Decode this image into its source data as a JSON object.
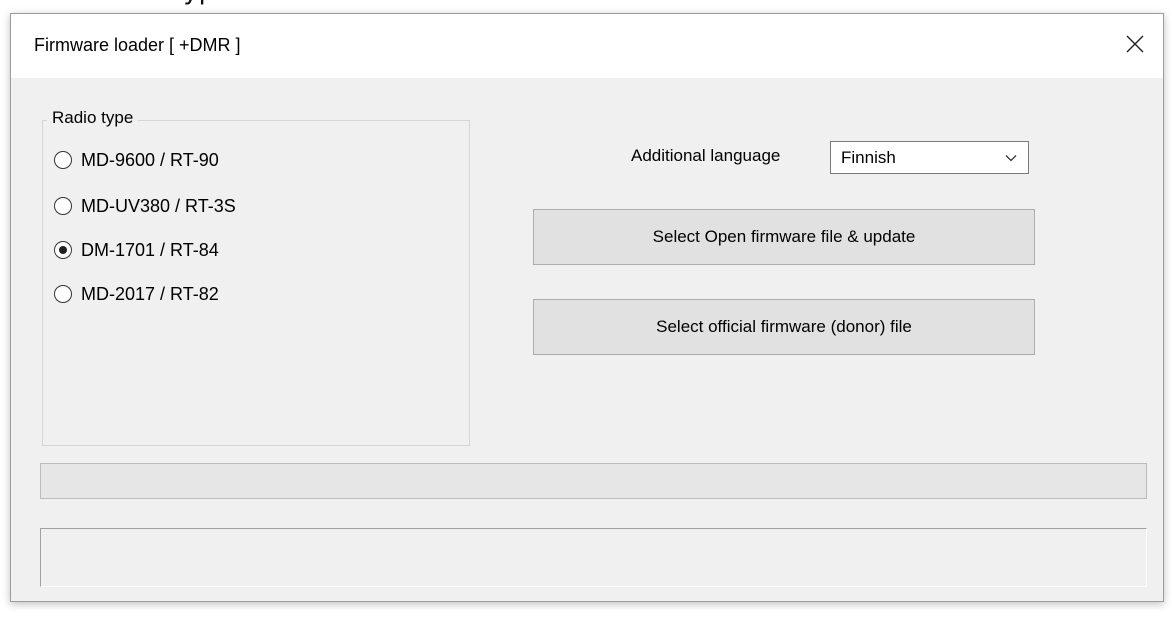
{
  "window": {
    "title": "Firmware loader [ +DMR ]"
  },
  "icons": {
    "close": "close-icon",
    "dropdown": "chevron-down-icon"
  },
  "radio_group": {
    "label": "Radio type",
    "options": [
      {
        "label": "MD-9600 / RT-90",
        "checked": false
      },
      {
        "label": "MD-UV380 / RT-3S",
        "checked": false
      },
      {
        "label": "DM-1701 / RT-84",
        "checked": true
      },
      {
        "label": "MD-2017 / RT-82",
        "checked": false
      }
    ]
  },
  "language": {
    "label": "Additional language",
    "selected": "Finnish"
  },
  "buttons": {
    "open_firmware": "Select Open firmware file & update",
    "official_firmware": "Select official firmware (donor) file"
  },
  "progress": {
    "value": 0
  },
  "status": {
    "text": ""
  },
  "colors": {
    "dialog_background": "#f0f0f0",
    "titlebar_background": "#ffffff",
    "button_background": "#e1e1e1",
    "progress_fill": "#06b025"
  }
}
